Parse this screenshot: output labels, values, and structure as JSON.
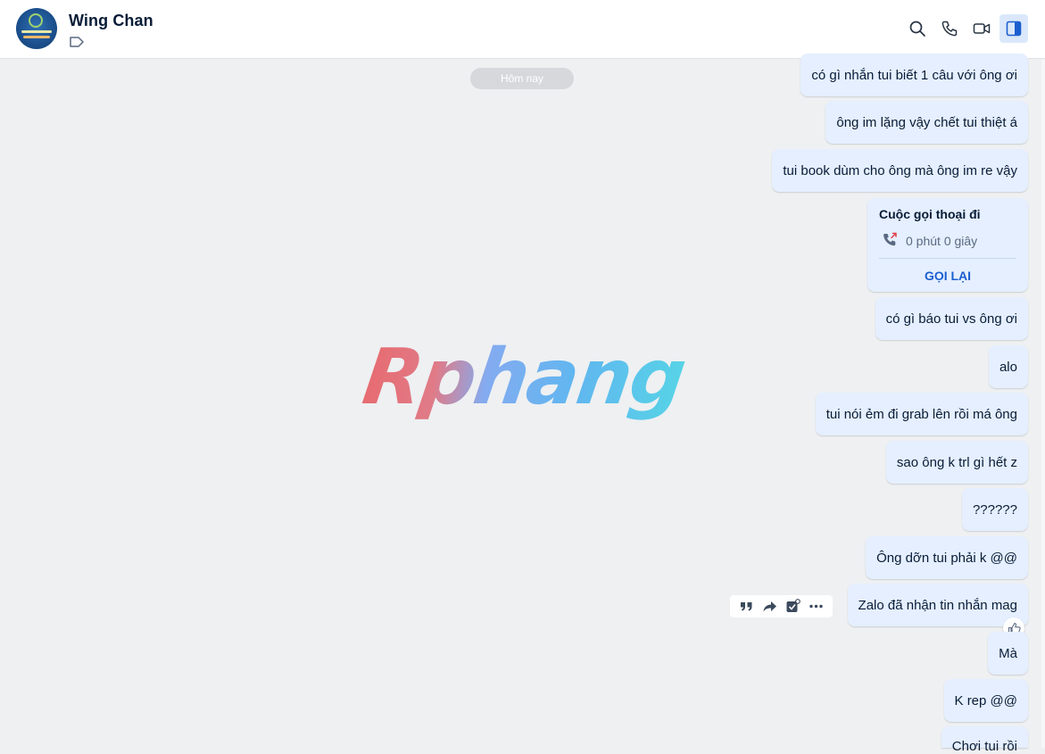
{
  "header": {
    "contact_name": "Wing Chan",
    "icons": [
      "search-icon",
      "phone-icon",
      "video-call-icon",
      "sidebar-toggle-icon"
    ]
  },
  "conversation": {
    "date_divider": "Hôm nay",
    "watermark": "Rphang",
    "messages": [
      {
        "text": "có gì nhắn tui biết 1 câu với ông ơi"
      },
      {
        "text": "ông im lặng vậy chết tui thiệt á"
      },
      {
        "text": "tui book dùm cho ông mà ông im re vậy"
      },
      {
        "text": "có gì báo tui vs ông ơi"
      },
      {
        "text": "alo"
      },
      {
        "text": "tui nói ẻm đi grab lên rồi má ông"
      },
      {
        "text": "sao ông k trl gì hết z"
      },
      {
        "text": "??????"
      },
      {
        "text": "Ông dỡn tui phải k @@"
      },
      {
        "text": "Zalo đã nhận tin nhắn mag"
      },
      {
        "text": "Mà"
      },
      {
        "text": "K rep @@"
      },
      {
        "text": "Chơi tui rồi"
      }
    ],
    "call_card": {
      "title": "Cuộc gọi thoại đi",
      "duration": "0 phút 0 giây",
      "action": "GỌI LẠI"
    },
    "message_actions": [
      "quote-icon",
      "forward-icon",
      "task-icon",
      "more-icon"
    ],
    "reaction_icon": "thumbs-up-icon"
  },
  "colors": {
    "bubble_bg": "#e5efff",
    "chat_bg": "#eef0f2",
    "accent": "#1b5fcf"
  }
}
